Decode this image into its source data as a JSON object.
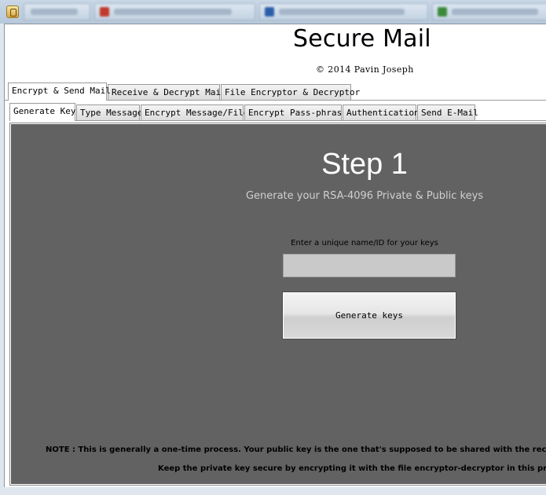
{
  "app": {
    "title": "Secure Mail",
    "copyright": "© 2014 Pavin Joseph"
  },
  "taskbar": {
    "icon": "java-cup-icon"
  },
  "main_tabs": [
    {
      "label": "Encrypt & Send Mail",
      "active": true
    },
    {
      "label": "Receive & Decrypt Mail",
      "active": false
    },
    {
      "label": "File Encryptor & Decryptor",
      "active": false
    }
  ],
  "sub_tabs": [
    {
      "label": "Generate Key",
      "active": true
    },
    {
      "label": "Type Message",
      "active": false
    },
    {
      "label": "Encrypt Message/File",
      "active": false
    },
    {
      "label": "Encrypt Pass-phrase",
      "active": false
    },
    {
      "label": "Authentication",
      "active": false
    },
    {
      "label": "Send E-Mail",
      "active": false
    }
  ],
  "step": {
    "title": "Step 1",
    "subtitle": "Generate your RSA-4096 Private & Public keys",
    "field_label": "Enter a unique name/ID for your keys",
    "field_value": "",
    "button_label": "Generate keys"
  },
  "notes": {
    "line1": "NOTE : This is generally a one-time process. Your public key is the one that's supposed to be shared with the recipie",
    "line2": "Keep the private key secure by encrypting it with the file encryptor-decryptor in this proc"
  },
  "colors": {
    "panel_bg": "#626262",
    "subtitle": "#cfcfcf"
  }
}
